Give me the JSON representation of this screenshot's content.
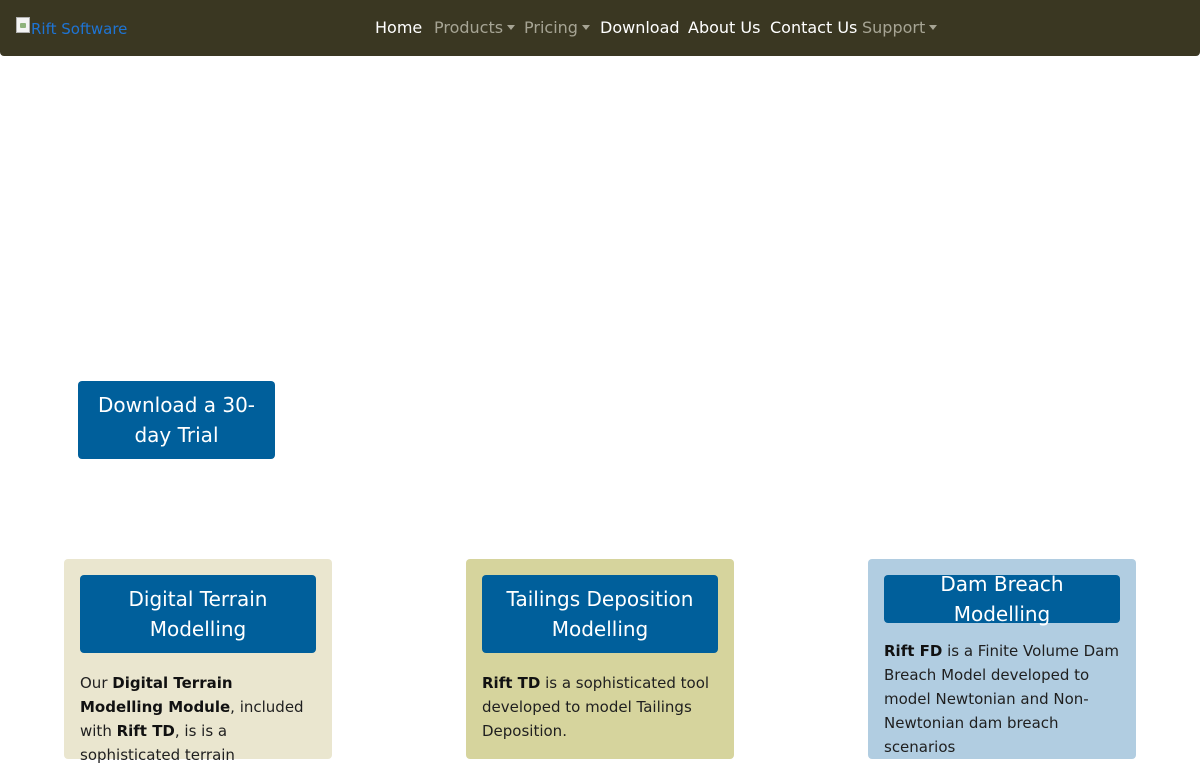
{
  "brand": {
    "alt_text": "Rift Software"
  },
  "nav": {
    "items": [
      {
        "label": "Home"
      },
      {
        "label": "Products"
      },
      {
        "label": "Pricing"
      },
      {
        "label": "Download"
      },
      {
        "label": "About Us"
      },
      {
        "label": "Contact Us"
      },
      {
        "label": "Support"
      }
    ]
  },
  "hero": {
    "trial_button": "Download a 30-day Trial"
  },
  "cards": [
    {
      "title": "Digital Terrain Modelling",
      "text": {
        "t1": "Our ",
        "b1": "Digital Terrain Modelling Module",
        "t2": ", included with ",
        "b2": "Rift TD",
        "t3": ", is is a sophisticated terrain"
      }
    },
    {
      "title": "Tailings Deposition Modelling",
      "text": {
        "b1": "Rift TD",
        "t1": " is a sophisticated tool developed to model Tailings Deposition."
      }
    },
    {
      "title": "Dam Breach Modelling",
      "text": {
        "b1": "Rift FD",
        "t1": " is a Finite Volume Dam Breach Model developed to model Newtonian and Non-Newtonian dam breach scenarios"
      }
    }
  ]
}
